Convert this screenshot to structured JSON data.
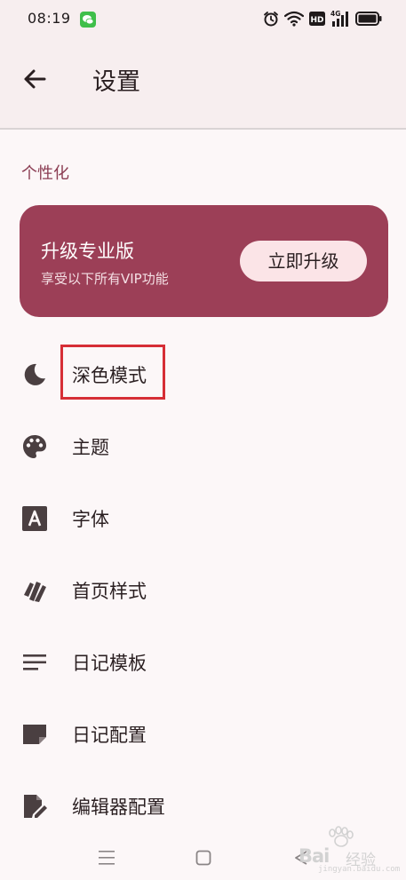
{
  "status_bar": {
    "time": "08:19",
    "network_label": "4G",
    "hd_label": "HD",
    "icons": [
      "wechat-icon",
      "alarm-icon",
      "wifi-icon",
      "hd-icon",
      "signal-icon",
      "battery-icon"
    ]
  },
  "app_bar": {
    "title": "设置",
    "back_icon": "arrow-left-icon"
  },
  "section": {
    "title": "个性化"
  },
  "upgrade_card": {
    "title": "升级专业版",
    "subtitle": "享受以下所有VIP功能",
    "button_label": "立即升级",
    "background_color": "#9c3f57",
    "button_color": "#fbe4e7"
  },
  "settings": {
    "items": [
      {
        "label": "深色模式",
        "icon": "moon-icon"
      },
      {
        "label": "主题",
        "icon": "palette-icon"
      },
      {
        "label": "字体",
        "icon": "font-icon"
      },
      {
        "label": "首页样式",
        "icon": "cards-icon"
      },
      {
        "label": "日记模板",
        "icon": "text-lines-icon"
      },
      {
        "label": "日记配置",
        "icon": "note-icon"
      },
      {
        "label": "编辑器配置",
        "icon": "edit-note-icon"
      }
    ]
  },
  "navigation": {
    "icons": [
      "menu-icon",
      "home-square-icon",
      "back-triangle-icon"
    ]
  },
  "watermark": {
    "text": "Bai",
    "text_suffix": "经验",
    "url": "jingyan.baidu.com"
  },
  "colors": {
    "accent": "#8b3d53",
    "highlight_border": "#d62e36",
    "app_bar_bg": "#f7eeef",
    "page_bg": "#fcf7f8"
  }
}
